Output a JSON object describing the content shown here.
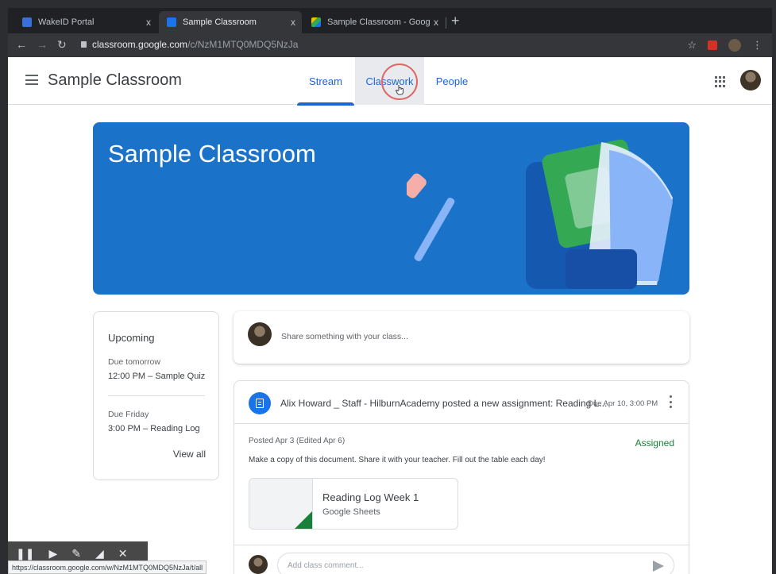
{
  "browser": {
    "tabs": [
      {
        "title": "WakeID Portal",
        "active": false,
        "favicon_color": "#3a6fd8"
      },
      {
        "title": "Sample Classroom",
        "active": true,
        "favicon_color": "#1a73e8"
      },
      {
        "title": "Sample Classroom - Google Driv",
        "active": false,
        "favicon_color": "#fbbc04"
      }
    ],
    "close_glyph": "x",
    "new_tab_glyph": "+",
    "url_host": "classroom.google.com",
    "url_path": "/c/NzM1MTQ0MDQ5NzJa",
    "status_url": "https://classroom.google.com/w/NzM1MTQ0MDQ5NzJa/t/all"
  },
  "header": {
    "title": "Sample Classroom",
    "tabs": [
      {
        "label": "Stream",
        "active": true
      },
      {
        "label": "Classwork",
        "active": false,
        "hover": true
      },
      {
        "label": "People",
        "active": false
      }
    ]
  },
  "banner": {
    "title": "Sample Classroom",
    "color": "#1a73c9"
  },
  "upcoming": {
    "title": "Upcoming",
    "items": [
      {
        "due": "Due tomorrow",
        "detail": "12:00 PM – Sample Quiz"
      },
      {
        "due": "Due Friday",
        "detail": "3:00 PM – Reading Log"
      }
    ],
    "view_all": "View all"
  },
  "share": {
    "placeholder": "Share something with your class..."
  },
  "post": {
    "header": "Alix Howard _ Staff - HilburnAcademy posted a new assignment: Reading L...",
    "date": "Due Apr 10, 3:00 PM",
    "meta": "Posted Apr 3 (Edited Apr 6)",
    "status": "Assigned",
    "description": "Make a copy of this document. Share it with your teacher. Fill out the table each day!",
    "attachment": {
      "name": "Reading Log Week 1",
      "type": "Google Sheets"
    },
    "comment_placeholder": "Add class comment..."
  },
  "colors": {
    "accent": "#1967d2",
    "assigned": "#188038"
  }
}
